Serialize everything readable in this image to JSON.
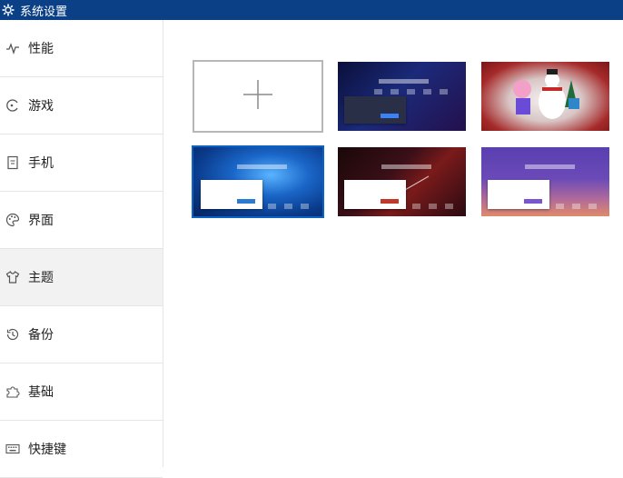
{
  "window": {
    "title": "系统设置",
    "icon": "gear-icon"
  },
  "sidebar": {
    "items": [
      {
        "label": "性能",
        "icon": "pulse-icon"
      },
      {
        "label": "游戏",
        "icon": "gamepad-icon"
      },
      {
        "label": "手机",
        "icon": "phone-icon"
      },
      {
        "label": "界面",
        "icon": "palette-icon"
      },
      {
        "label": "主题",
        "icon": "tshirt-icon",
        "active": true
      },
      {
        "label": "备份",
        "icon": "history-icon"
      },
      {
        "label": "基础",
        "icon": "puzzle-icon"
      },
      {
        "label": "快捷键",
        "icon": "keyboard-icon"
      }
    ]
  },
  "themes": {
    "tiles": [
      {
        "name": "add-theme",
        "icon": "plus-icon"
      },
      {
        "name": "theme-dark-blue"
      },
      {
        "name": "theme-christmas"
      },
      {
        "name": "theme-windows-blue",
        "selected": true
      },
      {
        "name": "theme-dark-red"
      },
      {
        "name": "theme-purple-sunset"
      }
    ]
  },
  "colors": {
    "titlebar": "#0b3f86",
    "selected_outline": "#0b62c4"
  }
}
